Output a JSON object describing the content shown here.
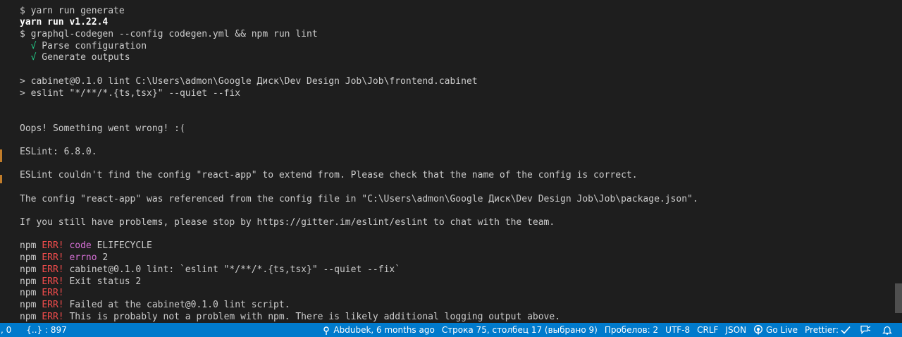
{
  "terminal": {
    "lines": [
      {
        "type": "plain",
        "text": ""
      },
      {
        "type": "plain",
        "text": "$ yarn run generate"
      },
      {
        "type": "bold",
        "text": "yarn run v1.22.4"
      },
      {
        "type": "plain",
        "text": "$ graphql-codegen --config codegen.yml && npm run lint"
      },
      {
        "type": "check",
        "mark": "√",
        "text": " Parse configuration"
      },
      {
        "type": "check",
        "mark": "√",
        "text": " Generate outputs"
      },
      {
        "type": "plain",
        "text": ""
      },
      {
        "type": "plain",
        "text": "> cabinet@0.1.0 lint C:\\Users\\admon\\Google Диск\\Dev Design Job\\Job\\frontend.cabinet"
      },
      {
        "type": "plain",
        "text": "> eslint \"*/**/*.{ts,tsx}\" --quiet --fix"
      },
      {
        "type": "plain",
        "text": ""
      },
      {
        "type": "plain",
        "text": ""
      },
      {
        "type": "plain",
        "text": "Oops! Something went wrong! :("
      },
      {
        "type": "plain",
        "text": ""
      },
      {
        "type": "plain",
        "text": "ESLint: 6.8.0."
      },
      {
        "type": "plain",
        "text": ""
      },
      {
        "type": "plain",
        "text": "ESLint couldn't find the config \"react-app\" to extend from. Please check that the name of the config is correct."
      },
      {
        "type": "plain",
        "text": ""
      },
      {
        "type": "plain",
        "text": "The config \"react-app\" was referenced from the config file in \"C:\\Users\\admon\\Google Диск\\Dev Design Job\\Job\\package.json\"."
      },
      {
        "type": "plain",
        "text": ""
      },
      {
        "type": "plain",
        "text": "If you still have problems, please stop by https://gitter.im/eslint/eslint to chat with the team."
      },
      {
        "type": "plain",
        "text": ""
      },
      {
        "type": "npm",
        "prefix": "npm ",
        "err": "ERR!",
        "kw": " code",
        "text": " ELIFECYCLE"
      },
      {
        "type": "npm",
        "prefix": "npm ",
        "err": "ERR!",
        "kw": " errno",
        "text": " 2"
      },
      {
        "type": "npm",
        "prefix": "npm ",
        "err": "ERR!",
        "kw": "",
        "text": " cabinet@0.1.0 lint: `eslint \"*/**/*.{ts,tsx}\" --quiet --fix`"
      },
      {
        "type": "npm",
        "prefix": "npm ",
        "err": "ERR!",
        "kw": "",
        "text": " Exit status 2"
      },
      {
        "type": "npm",
        "prefix": "npm ",
        "err": "ERR!",
        "kw": "",
        "text": ""
      },
      {
        "type": "npm",
        "prefix": "npm ",
        "err": "ERR!",
        "kw": "",
        "text": " Failed at the cabinet@0.1.0 lint script."
      },
      {
        "type": "npm",
        "prefix": "npm ",
        "err": "ERR!",
        "kw": "",
        "text": " This is probably not a problem with npm. There is likely additional logging output above."
      }
    ]
  },
  "statusbar": {
    "left": {
      "cursor_fragment": ", 0",
      "json_selector": "{..} : 897"
    },
    "right": [
      {
        "name": "git-blame",
        "icon": "git-commit-icon",
        "label": "Abdubek, 6 months ago"
      },
      {
        "name": "cursor-position",
        "icon": "",
        "label": "Строка 75, столбец 17 (выбрано 9)"
      },
      {
        "name": "indentation",
        "icon": "",
        "label": "Пробелов: 2"
      },
      {
        "name": "encoding",
        "icon": "",
        "label": "UTF-8"
      },
      {
        "name": "line-endings",
        "icon": "",
        "label": "CRLF"
      },
      {
        "name": "language-mode",
        "icon": "",
        "label": "JSON"
      },
      {
        "name": "go-live",
        "icon": "broadcast-icon",
        "label": "Go Live"
      },
      {
        "name": "prettier",
        "icon": "checkmark-icon",
        "label": "Prettier:"
      },
      {
        "name": "feedback",
        "icon": "feedback-icon",
        "label": ""
      },
      {
        "name": "notifications",
        "icon": "bell-icon",
        "label": ""
      }
    ]
  },
  "colors": {
    "terminal_bg": "#1e1e1e",
    "statusbar_bg": "#007acc",
    "success": "#23d18b",
    "error": "#f14c4c",
    "keyword": "#d670d6"
  }
}
